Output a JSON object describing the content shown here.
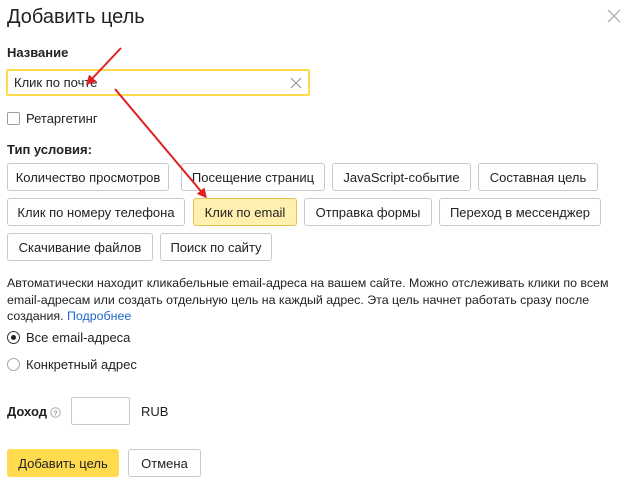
{
  "dialog": {
    "title": "Добавить цель",
    "close_icon": "close-icon"
  },
  "name_section": {
    "label": "Название",
    "value": "Клик по почте",
    "placeholder": ""
  },
  "retargeting": {
    "label": "Ретаргетинг",
    "checked": false
  },
  "condition": {
    "label": "Тип условия:",
    "options": [
      {
        "label": "Количество просмотров",
        "active": false
      },
      {
        "label": "Посещение страниц",
        "active": false
      },
      {
        "label": "JavaScript-событие",
        "active": false
      },
      {
        "label": "Составная цель",
        "active": false
      },
      {
        "label": "Клик по номеру телефона",
        "active": false
      },
      {
        "label": "Клик по email",
        "active": true
      },
      {
        "label": "Отправка формы",
        "active": false
      },
      {
        "label": "Переход в мессенджер",
        "active": false
      },
      {
        "label": "Скачивание файлов",
        "active": false
      },
      {
        "label": "Поиск по сайту",
        "active": false
      }
    ]
  },
  "description": {
    "text": "Автоматически находит кликабельные email-адреса на вашем сайте. Можно отслеживать клики по всем email-адресам или создать отдельную цель на каждый адрес. Эта цель начнет работать сразу после создания.",
    "link": "Подробнее"
  },
  "address_mode": {
    "options": [
      {
        "label": "Все email-адреса",
        "checked": true
      },
      {
        "label": "Конкретный адрес",
        "checked": false
      }
    ]
  },
  "income": {
    "label": "Доход",
    "value": "",
    "currency": "RUB"
  },
  "actions": {
    "submit": "Добавить цель",
    "cancel": "Отмена"
  },
  "colors": {
    "accent": "#ffdb4d",
    "active_option": "#fff0b0",
    "link": "#1c67c9",
    "annotation_arrow": "#e02020"
  }
}
